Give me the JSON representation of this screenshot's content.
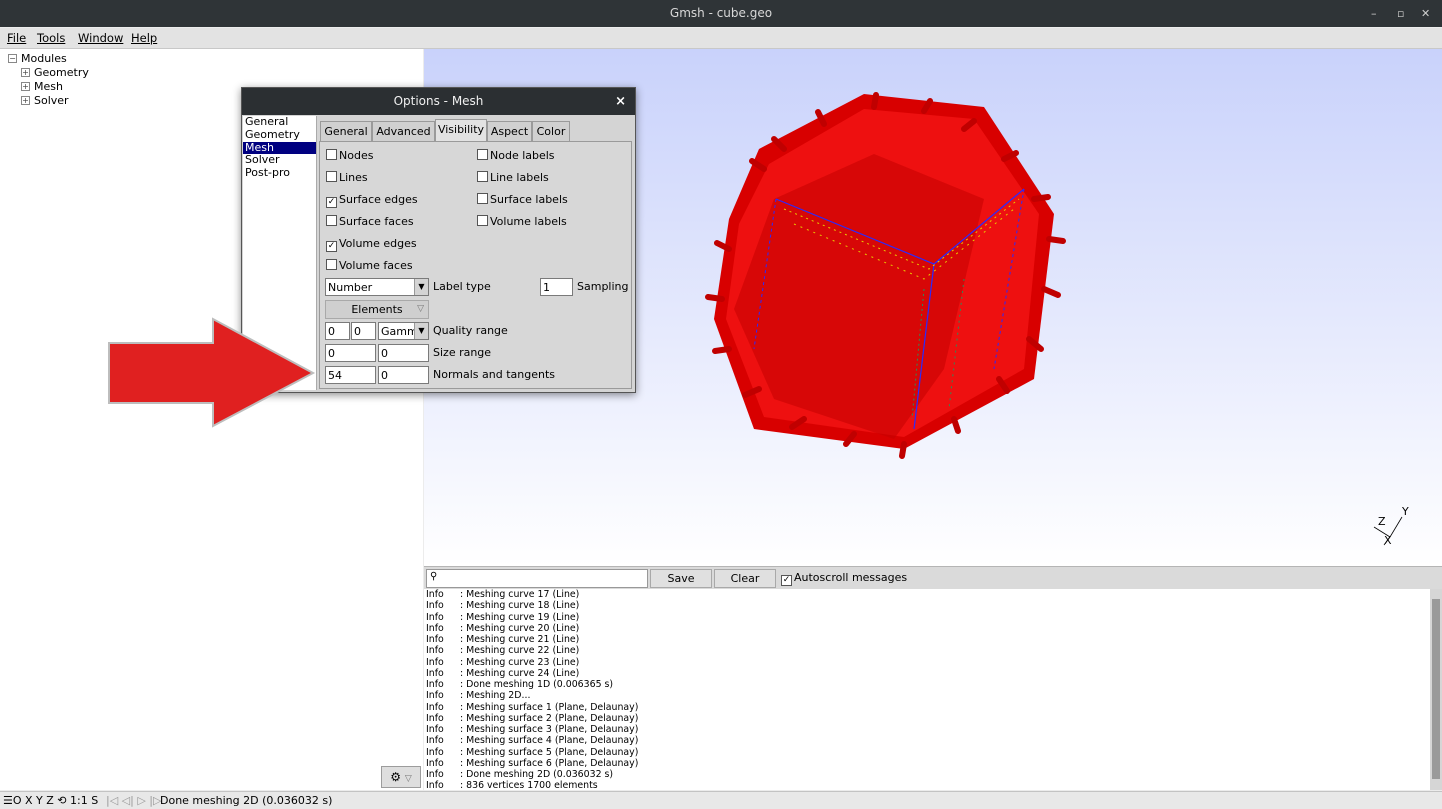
{
  "window": {
    "title": "Gmsh - cube.geo",
    "controls": [
      "–",
      "▫",
      "✕"
    ]
  },
  "menu": [
    "File",
    "Tools",
    "Window",
    "Help"
  ],
  "tree": {
    "root": "Modules",
    "children": [
      "Geometry",
      "Mesh",
      "Solver"
    ]
  },
  "dialog": {
    "title": "Options - Mesh",
    "close": "×",
    "categories": [
      "General",
      "Geometry",
      "Mesh",
      "Solver",
      "Post-pro"
    ],
    "selected_category": "Mesh",
    "tabs": [
      "General",
      "Advanced",
      "Visibility",
      "Aspect",
      "Color"
    ],
    "active_tab": "Visibility",
    "checks_left": [
      {
        "label": "Nodes",
        "checked": false
      },
      {
        "label": "Lines",
        "checked": false
      },
      {
        "label": "Surface edges",
        "checked": true
      },
      {
        "label": "Surface faces",
        "checked": false
      },
      {
        "label": "Volume edges",
        "checked": true
      },
      {
        "label": "Volume faces",
        "checked": false
      }
    ],
    "checks_right": [
      {
        "label": "Node labels",
        "checked": false
      },
      {
        "label": "Line labels",
        "checked": false
      },
      {
        "label": "Surface labels",
        "checked": false
      },
      {
        "label": "Volume labels",
        "checked": false
      }
    ],
    "label_type": {
      "value": "Number",
      "label": "Label type"
    },
    "sampling": {
      "value": "1",
      "label": "Sampling"
    },
    "elements_button": "Elements",
    "quality_range": {
      "min": "0",
      "max": "0",
      "measure": "Gamm",
      "label": "Quality range"
    },
    "size_range": {
      "min": "0",
      "max": "0",
      "label": "Size range"
    },
    "normals_tangents": {
      "normals": "54",
      "tangents": "0",
      "label": "Normals and tangents"
    }
  },
  "messages": {
    "save_label": "Save",
    "clear_label": "Clear",
    "autoscroll_label": "Autoscroll messages",
    "autoscroll_checked": true,
    "search_value": "",
    "lines": [
      [
        "Info",
        ": Meshing curve 17 (Line)"
      ],
      [
        "Info",
        ": Meshing curve 18 (Line)"
      ],
      [
        "Info",
        ": Meshing curve 19 (Line)"
      ],
      [
        "Info",
        ": Meshing curve 20 (Line)"
      ],
      [
        "Info",
        ": Meshing curve 21 (Line)"
      ],
      [
        "Info",
        ": Meshing curve 22 (Line)"
      ],
      [
        "Info",
        ": Meshing curve 23 (Line)"
      ],
      [
        "Info",
        ": Meshing curve 24 (Line)"
      ],
      [
        "Info",
        ": Done meshing 1D (0.006365 s)"
      ],
      [
        "Info",
        ": Meshing 2D..."
      ],
      [
        "Info",
        ": Meshing surface 1 (Plane, Delaunay)"
      ],
      [
        "Info",
        ": Meshing surface 2 (Plane, Delaunay)"
      ],
      [
        "Info",
        ": Meshing surface 3 (Plane, Delaunay)"
      ],
      [
        "Info",
        ": Meshing surface 4 (Plane, Delaunay)"
      ],
      [
        "Info",
        ": Meshing surface 5 (Plane, Delaunay)"
      ],
      [
        "Info",
        ": Meshing surface 6 (Plane, Delaunay)"
      ],
      [
        "Info",
        ": Done meshing 2D (0.036032 s)"
      ],
      [
        "Info",
        ": 836 vertices 1700 elements"
      ]
    ]
  },
  "status": {
    "quick_buttons": "☰O X Y Z ⟲ 1:1 S",
    "playback": "|◁ ◁| ▷ |▷",
    "message": "Done meshing 2D (0.036032 s)"
  },
  "axes": {
    "labels": [
      "Z",
      "Y",
      "X"
    ]
  },
  "colors": {
    "normals": "#e00000",
    "edges_blue": "#2a2aff",
    "edges_yellow": "#e8c800",
    "arrow": "#e02020"
  }
}
